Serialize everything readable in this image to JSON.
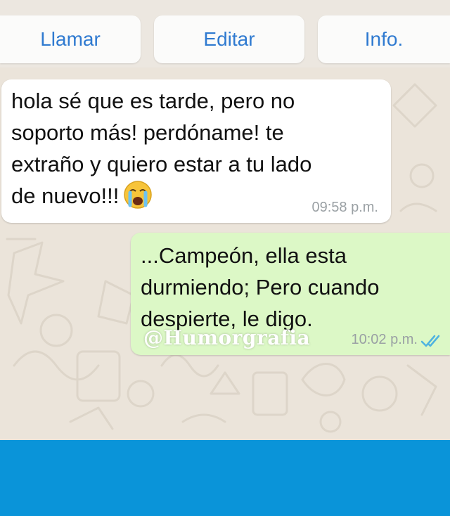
{
  "header": {
    "buttons": {
      "call": "Llamar",
      "edit": "Editar",
      "info": "Info."
    }
  },
  "messages": [
    {
      "direction": "incoming",
      "text": "hola sé que es tarde, pero no\nsoporto más! perdóname! te\nextraño y quiero estar a tu lado\nde nuevo!!!",
      "emoji": "crying-face",
      "time": "09:58 p.m."
    },
    {
      "direction": "outgoing",
      "text": "...Campeón, ella esta\ndurmiendo; Pero cuando\ndespierte, le digo.",
      "time": "10:02 p.m.",
      "status": "read-double-check",
      "watermark": "@Humorgrafia"
    }
  ],
  "colors": {
    "accent": "#2f7ad0",
    "incoming_bubble": "#ffffff",
    "outgoing_bubble": "#dcf8c6",
    "chat_background": "#ebe4da",
    "bottom_bar": "#0a94d9",
    "read_check": "#4fb3e0"
  }
}
